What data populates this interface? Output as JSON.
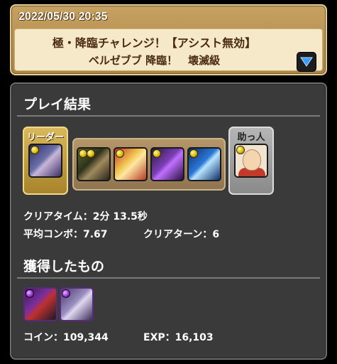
{
  "header": {
    "datetime": "2022/05/30 20:35",
    "title_line1": "極・降臨チャレンジ！【アシスト無効】",
    "title_line2": "ベルゼブブ 降臨！　壊滅級"
  },
  "results": {
    "title": "プレイ結果",
    "team": {
      "leader_label": "リーダー",
      "helper_label": "助っ人"
    },
    "clear_time_label": "クリアタイム：",
    "clear_time_value": "2分 13.5秒",
    "avg_combo_label": "平均コンボ：",
    "avg_combo_value": "7.67",
    "clear_turns_label": "クリアターン：",
    "clear_turns_value": "6"
  },
  "rewards": {
    "title": "獲得したもの",
    "coin_label": "コイン：",
    "coin_value": "109,344",
    "exp_label": "EXP：",
    "exp_value": "16,103"
  },
  "colors": {
    "header_gold": "#c6a161",
    "panel_gray": "#3a3a3a",
    "leader_gold": "#d9b85a",
    "helper_silver": "#b5b5b5"
  }
}
